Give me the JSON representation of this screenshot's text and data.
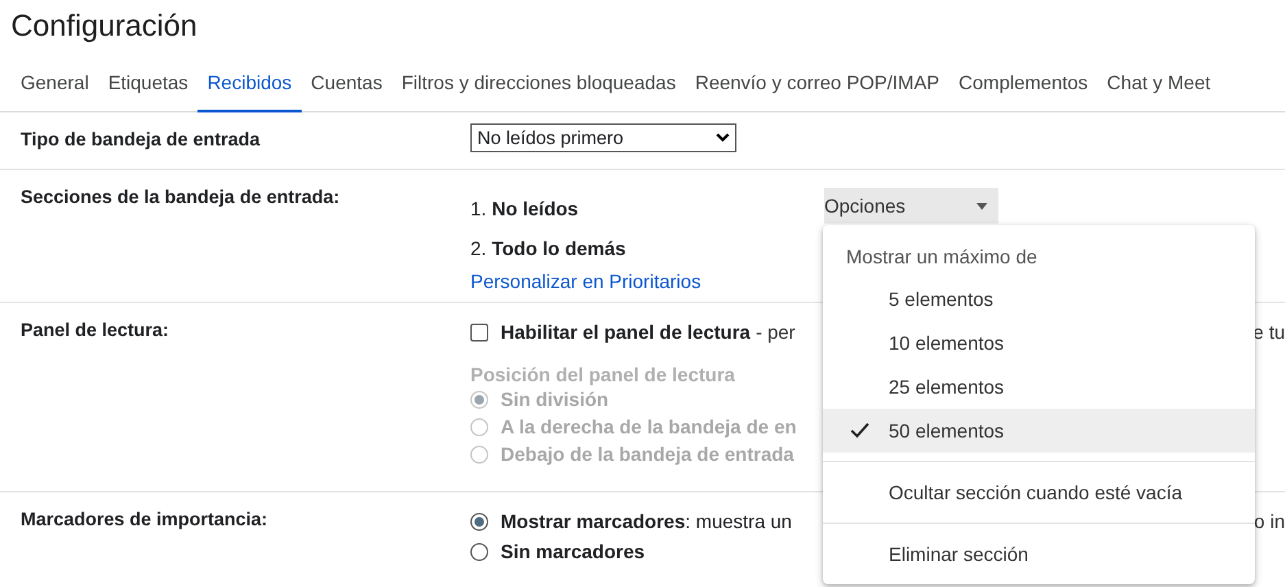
{
  "title": "Configuración",
  "tabs": [
    {
      "label": "General",
      "selected": false
    },
    {
      "label": "Etiquetas",
      "selected": false
    },
    {
      "label": "Recibidos",
      "selected": true
    },
    {
      "label": "Cuentas",
      "selected": false
    },
    {
      "label": "Filtros y direcciones bloqueadas",
      "selected": false
    },
    {
      "label": "Reenvío y correo POP/IMAP",
      "selected": false
    },
    {
      "label": "Complementos",
      "selected": false
    },
    {
      "label": "Chat y Meet",
      "selected": false
    }
  ],
  "inbox_type": {
    "label": "Tipo de bandeja de entrada",
    "value": "No leídos primero"
  },
  "inbox_sections": {
    "label": "Secciones de la bandeja de entrada:",
    "sections": [
      "1. **No leídos**",
      "2. **Todo lo demás**"
    ],
    "link": "Personalizar en Prioritarios",
    "options_button": "Opciones"
  },
  "reading_pane": {
    "label": "Panel de lectura:",
    "checkbox": {
      "label": "Habilitar el panel de lectura",
      "description": "- per",
      "description_end": "e tu",
      "checked": false
    },
    "position_heading": "Posición del panel de lectura",
    "disabled": true,
    "positions": [
      {
        "label": "Sin división",
        "selected": true
      },
      {
        "label": "A la derecha de la bandeja de en",
        "selected": false
      },
      {
        "label": "Debajo de la bandeja de entrada",
        "selected": false
      }
    ]
  },
  "importance": {
    "label": "Marcadores de importancia:",
    "options": [
      {
        "label": "**Mostrar marcadores**: muestra un",
        "label_end": "o in",
        "selected": true
      },
      {
        "label": "**Sin marcadores**",
        "selected": false
      }
    ]
  },
  "menu": {
    "header": "Mostrar un máximo de",
    "options": [
      {
        "label": "5 elementos",
        "selected": false
      },
      {
        "label": "10 elementos",
        "selected": false
      },
      {
        "label": "25 elementos",
        "selected": false
      },
      {
        "label": "50 elementos",
        "selected": true
      }
    ],
    "actions": [
      "Ocultar sección cuando esté vacía",
      "Eliminar sección"
    ]
  }
}
